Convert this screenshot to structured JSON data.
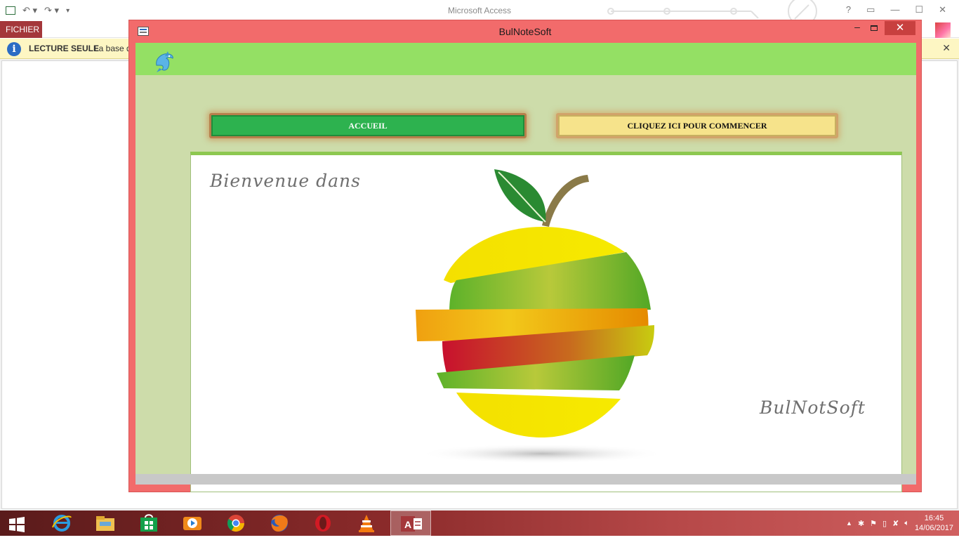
{
  "access": {
    "title": "Microsoft Access",
    "tab_fichier": "FICHIER",
    "info_label": "LECTURE SEULE",
    "info_text": "La base d",
    "help": "?",
    "min": "—",
    "max": "☐",
    "close": "✕"
  },
  "form": {
    "title": "BulNoteSoft",
    "close_glyph": "✕",
    "min_glyph": "–",
    "buttons": {
      "accueil": "ACCUEIL",
      "commencer": "CLIQUEZ ICI POUR COMMENCER"
    },
    "welcome": "Bienvenue dans",
    "brand": "BulNotSoft"
  },
  "taskbar": {
    "apps": [
      "start-icon",
      "ie-icon",
      "explorer-icon",
      "store-icon",
      "media-icon",
      "chrome-icon",
      "firefox-icon",
      "opera-icon",
      "vlc-icon",
      "access-icon"
    ],
    "time": "16:45",
    "date": "14/06/2017",
    "tray_arrow": "▲"
  },
  "colors": {
    "form_frame": "#f26b6b",
    "header_green": "#94e064",
    "client_bg": "#cddcaa",
    "accueil_green": "#2db24f",
    "commencer_yellow": "#f6e38b",
    "access_red": "#a4373a"
  }
}
